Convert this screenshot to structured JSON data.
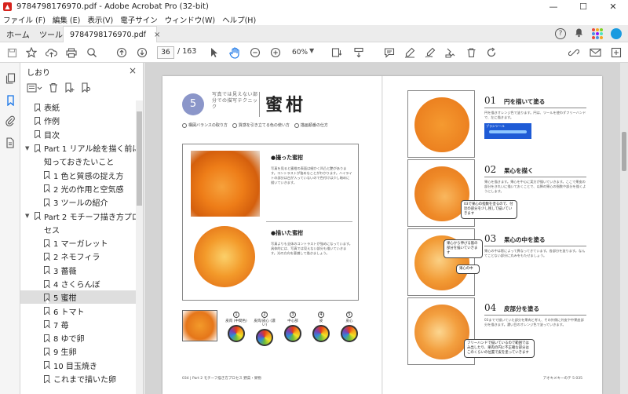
{
  "window": {
    "title": "9784798176970.pdf - Adobe Acrobat Pro (32-bit)",
    "minimize": "—",
    "maximize": "☐",
    "close": "✕"
  },
  "menu": [
    "ファイル (F)",
    "編集 (E)",
    "表示(V)",
    "電子サイン",
    "ウィンドウ(W)",
    "ヘルプ(H)"
  ],
  "tabs": {
    "home": "ホーム",
    "tools": "ツール",
    "document": "9784798176970.pdf",
    "close": "×"
  },
  "tabbar_icons": {
    "help": "?",
    "bell": "🔔"
  },
  "toolbar": {
    "current_page": "36",
    "total_pages": "/  163",
    "zoom": "60%"
  },
  "bookmarks": {
    "title": "しおり",
    "close": "×",
    "items": [
      {
        "label": "表紙",
        "level": 1,
        "caret": ""
      },
      {
        "label": "作例",
        "level": 1,
        "caret": ""
      },
      {
        "label": "目次",
        "level": 1,
        "caret": ""
      },
      {
        "label": "Part 1 リアル絵を描く前に",
        "level": 1,
        "caret": "▼"
      },
      {
        "label": "知っておきたいこと",
        "level": 1,
        "caret": "",
        "continuation": true
      },
      {
        "label": "1  色と質感の捉え方",
        "level": 2,
        "caret": ""
      },
      {
        "label": "2  光の作用と空気感",
        "level": 2,
        "caret": ""
      },
      {
        "label": "3  ツールの紹介",
        "level": 2,
        "caret": ""
      },
      {
        "label": "Part 2  モチーフ描き方プロ",
        "level": 1,
        "caret": "▼"
      },
      {
        "label": "セス",
        "level": 1,
        "caret": "",
        "continuation": true
      },
      {
        "label": "1  マーガレット",
        "level": 2,
        "caret": ""
      },
      {
        "label": "2  ネモフィラ",
        "level": 2,
        "caret": ""
      },
      {
        "label": "3  薔薇",
        "level": 2,
        "caret": ""
      },
      {
        "label": "4  さくらんぼ",
        "level": 2,
        "caret": ""
      },
      {
        "label": "5  蜜柑",
        "level": 2,
        "caret": "",
        "selected": true
      },
      {
        "label": "6  トマト",
        "level": 2,
        "caret": ""
      },
      {
        "label": "7  苺",
        "level": 2,
        "caret": ""
      },
      {
        "label": "8  ゆで卵",
        "level": 2,
        "caret": ""
      },
      {
        "label": "9  生卵",
        "level": 2,
        "caret": ""
      },
      {
        "label": "10  目玉焼き",
        "level": 2,
        "caret": ""
      },
      {
        "label": "これまで描いた卵",
        "level": 2,
        "caret": ""
      }
    ]
  },
  "page_left": {
    "number": "5",
    "subtitle": "写真では見えない部分での描写テクニック",
    "title": "蜜柑",
    "chips": [
      "構図バランスの取り方",
      "質感を引き立てる色の使い方",
      "描画順番の仕方"
    ],
    "photo_heading": "●撮った蜜柑",
    "photo_body": "写真を見ると蜜柑の表面は細かく凹凸と艶があります。コントラストが強めなことがわかります。ハイライトの部分は白が入っていないので色付けは少し暗めに描いていきます。",
    "painted_heading": "●描いた蜜柑",
    "painted_body": "写真よりも全体のコントラストが強めになっています。具体的には、写真では見えない部分も描いていきます。光の方向を意識して描きましょう。",
    "swatches": [
      {
        "num": "1",
        "label": "皮肉\n(中間色)"
      },
      {
        "num": "2",
        "label": "皮肉/皮心\n(濃い)"
      },
      {
        "num": "3",
        "label": "中心部"
      },
      {
        "num": "4",
        "label": "皮"
      },
      {
        "num": "5",
        "label": "皮心"
      }
    ],
    "footer": "034 | Part 2  モチーフ描き方プロセス  野菜・果物"
  },
  "page_right": {
    "steps": [
      {
        "num": "01",
        "title": "円を描いて塗る",
        "body": "円を描きオレンジ色で塗ります。円は、ツールを使わずフリーハンドで、左に描きます。"
      },
      {
        "num": "02",
        "title": "果心を描く",
        "body": "果心を描きます。果心を中心に実方が描いていきます。ここで果皮の部分をきれいに描いておくことで、以降の果心の指数や部分を描くようにします。"
      },
      {
        "num": "03",
        "title": "果心の中を塗る",
        "body": "果心の中は影によって異なってきています。各部分を塗ります。なんてことない部分に丸みをもたせましょう。"
      },
      {
        "num": "04",
        "title": "皮部分を塗る",
        "body": "03までで描いていた部分を果肉と考え、その外側に外皮や中果皮部分を描きます。濃い目のオレンジ色で塗っていきます。"
      }
    ],
    "brush_label": "ブラシツール",
    "callouts": [
      "03で果心の指数を塗るので、付近の部分を少し残して描いていきます",
      "果心から伸びる筋の部分を描いていきます",
      "果心の中",
      "フリーハンドで描いているので範囲ではみ出したり、果肉の円に不正確な部分はこのくらいの位置で皮を塗っていきます"
    ],
    "footer": "アオキメキーのテ  5  035"
  }
}
